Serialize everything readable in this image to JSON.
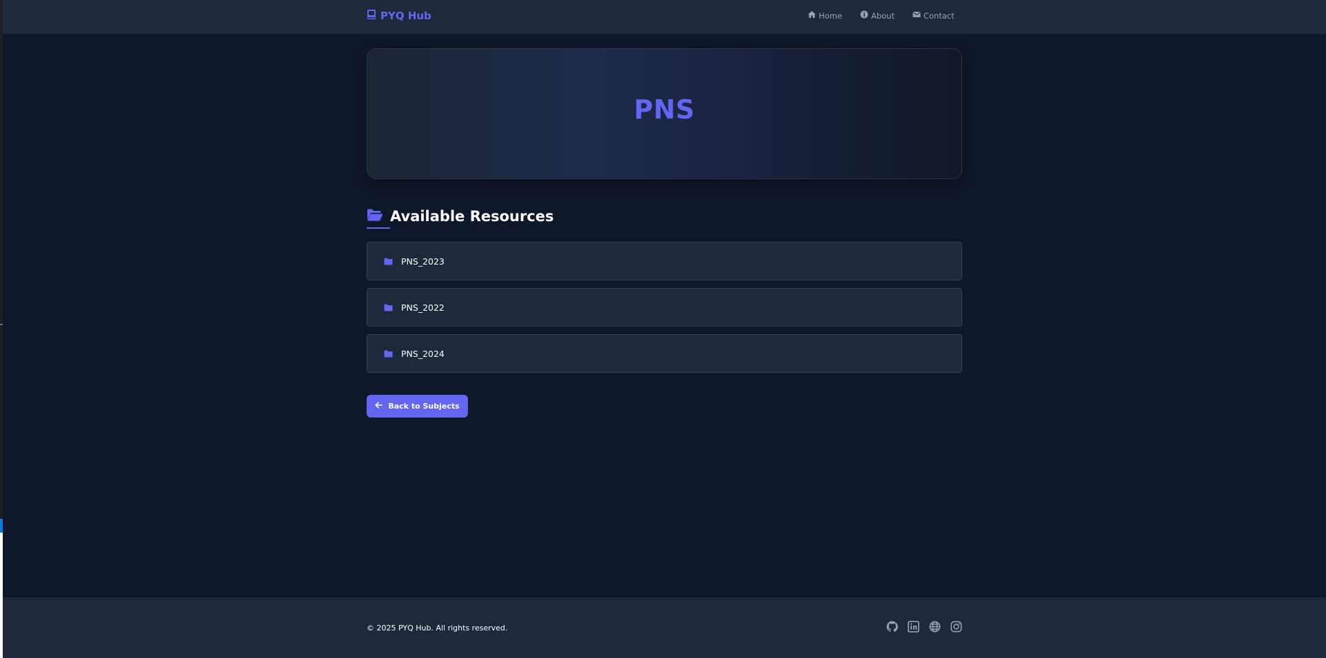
{
  "nav": {
    "brand": "PYQ Hub",
    "links": [
      {
        "label": "Home",
        "icon": "home-icon"
      },
      {
        "label": "About",
        "icon": "info-icon"
      },
      {
        "label": "Contact",
        "icon": "envelope-icon"
      }
    ]
  },
  "hero": {
    "title": "PNS"
  },
  "resources": {
    "heading": "Available Resources",
    "heading_icon": "folder-open-icon",
    "items": [
      {
        "label": "PNS_2023",
        "icon": "folder-icon"
      },
      {
        "label": "PNS_2022",
        "icon": "folder-icon"
      },
      {
        "label": "PNS_2024",
        "icon": "folder-icon"
      }
    ]
  },
  "back_button": {
    "label": "Back to Subjects",
    "icon": "arrow-left-icon"
  },
  "footer": {
    "copyright": "© 2025 PYQ Hub. All rights reserved.",
    "social": [
      "github-icon",
      "linkedin-icon",
      "globe-icon",
      "instagram-icon"
    ]
  },
  "colors": {
    "accent": "#6366f1",
    "background": "#0f172a",
    "surface": "#1e293b",
    "muted_text": "#94a3b8"
  }
}
